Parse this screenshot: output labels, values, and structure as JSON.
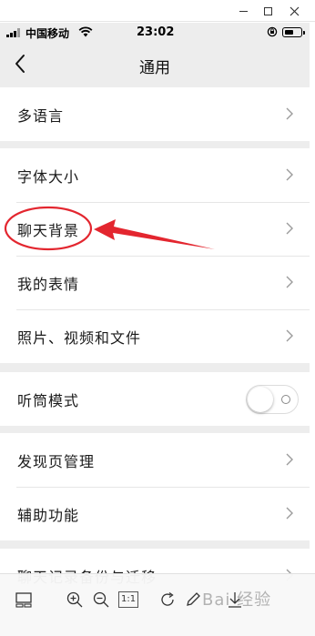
{
  "window": {
    "controls": [
      "minimize-icon",
      "maximize-icon",
      "close-icon"
    ]
  },
  "statusbar": {
    "carrier": "中国移动",
    "time": "23:02"
  },
  "navbar": {
    "title": "通用",
    "back_icon": "chevron-left-icon"
  },
  "groups": [
    {
      "items": [
        {
          "label": "多语言"
        }
      ]
    },
    {
      "items": [
        {
          "label": "字体大小"
        },
        {
          "label": "聊天背景"
        },
        {
          "label": "我的表情"
        },
        {
          "label": "照片、视频和文件"
        }
      ]
    },
    {
      "items": [
        {
          "label": "听筒模式",
          "toggle": false
        }
      ]
    },
    {
      "items": [
        {
          "label": "发现页管理"
        },
        {
          "label": "辅助功能"
        }
      ]
    },
    {
      "items": [
        {
          "label": "聊天记录备份与迁移"
        }
      ]
    }
  ],
  "annotation": {
    "color": "#e3262f",
    "target": "聊天背景"
  },
  "viewer_toolbar": {
    "actual_size_label": "1:1",
    "watermark": "Bai 经验"
  }
}
